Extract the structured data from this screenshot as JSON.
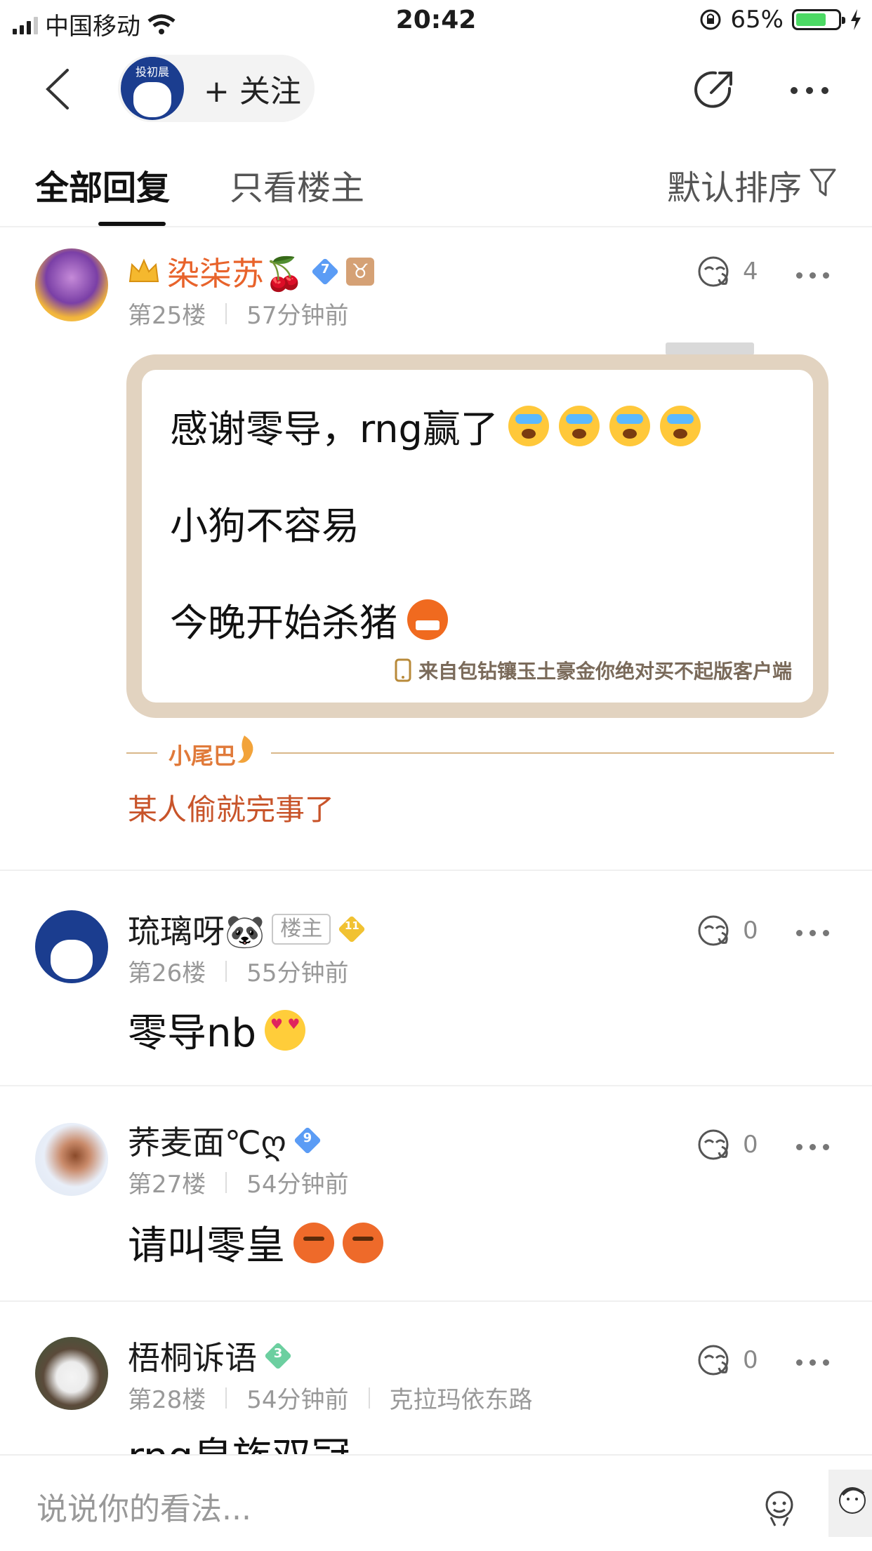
{
  "status_bar": {
    "carrier": "中国移动",
    "time": "20:42",
    "battery": "65%",
    "battery_level": 0.65
  },
  "nav": {
    "follow_label": "+ 关注",
    "follow_avatar_text": "投初晨"
  },
  "tabs": {
    "all": "全部回复",
    "op_only": "只看楼主",
    "sort": "默认排序"
  },
  "posts": [
    {
      "username": "染柒苏🍒",
      "username_color": "#e8632b",
      "level": "7",
      "floor": "第25楼",
      "time": "57分钟前",
      "likes": "4",
      "lines": [
        "感谢零导，rng赢了",
        "小狗不容易",
        "今晚开始杀猪"
      ],
      "source": "来自包钻镶玉土豪金你绝对买不起版客户端",
      "tail_label": "小尾巴",
      "tail_text": "某人偷就完事了"
    },
    {
      "username": "琉璃呀🐼",
      "badge": "楼主",
      "level": "11",
      "floor": "第26楼",
      "time": "55分钟前",
      "likes": "0",
      "content": "零导nb"
    },
    {
      "username": "荞麦面℃ღ",
      "level": "9",
      "floor": "第27楼",
      "time": "54分钟前",
      "likes": "0",
      "content": "请叫零皇"
    },
    {
      "username": "梧桐诉语",
      "level": "3",
      "floor": "第28楼",
      "time": "54分钟前",
      "location": "克拉玛依东路",
      "likes": "0",
      "content": "rng皇族双冠"
    }
  ],
  "input": {
    "placeholder": "说说你的看法..."
  },
  "icons": [
    "back-icon",
    "share-icon",
    "more-icon",
    "filter-icon",
    "like-icon",
    "emoji-icon",
    "sticker-icon",
    "phone-icon",
    "crown-icon",
    "taurus-icon"
  ]
}
